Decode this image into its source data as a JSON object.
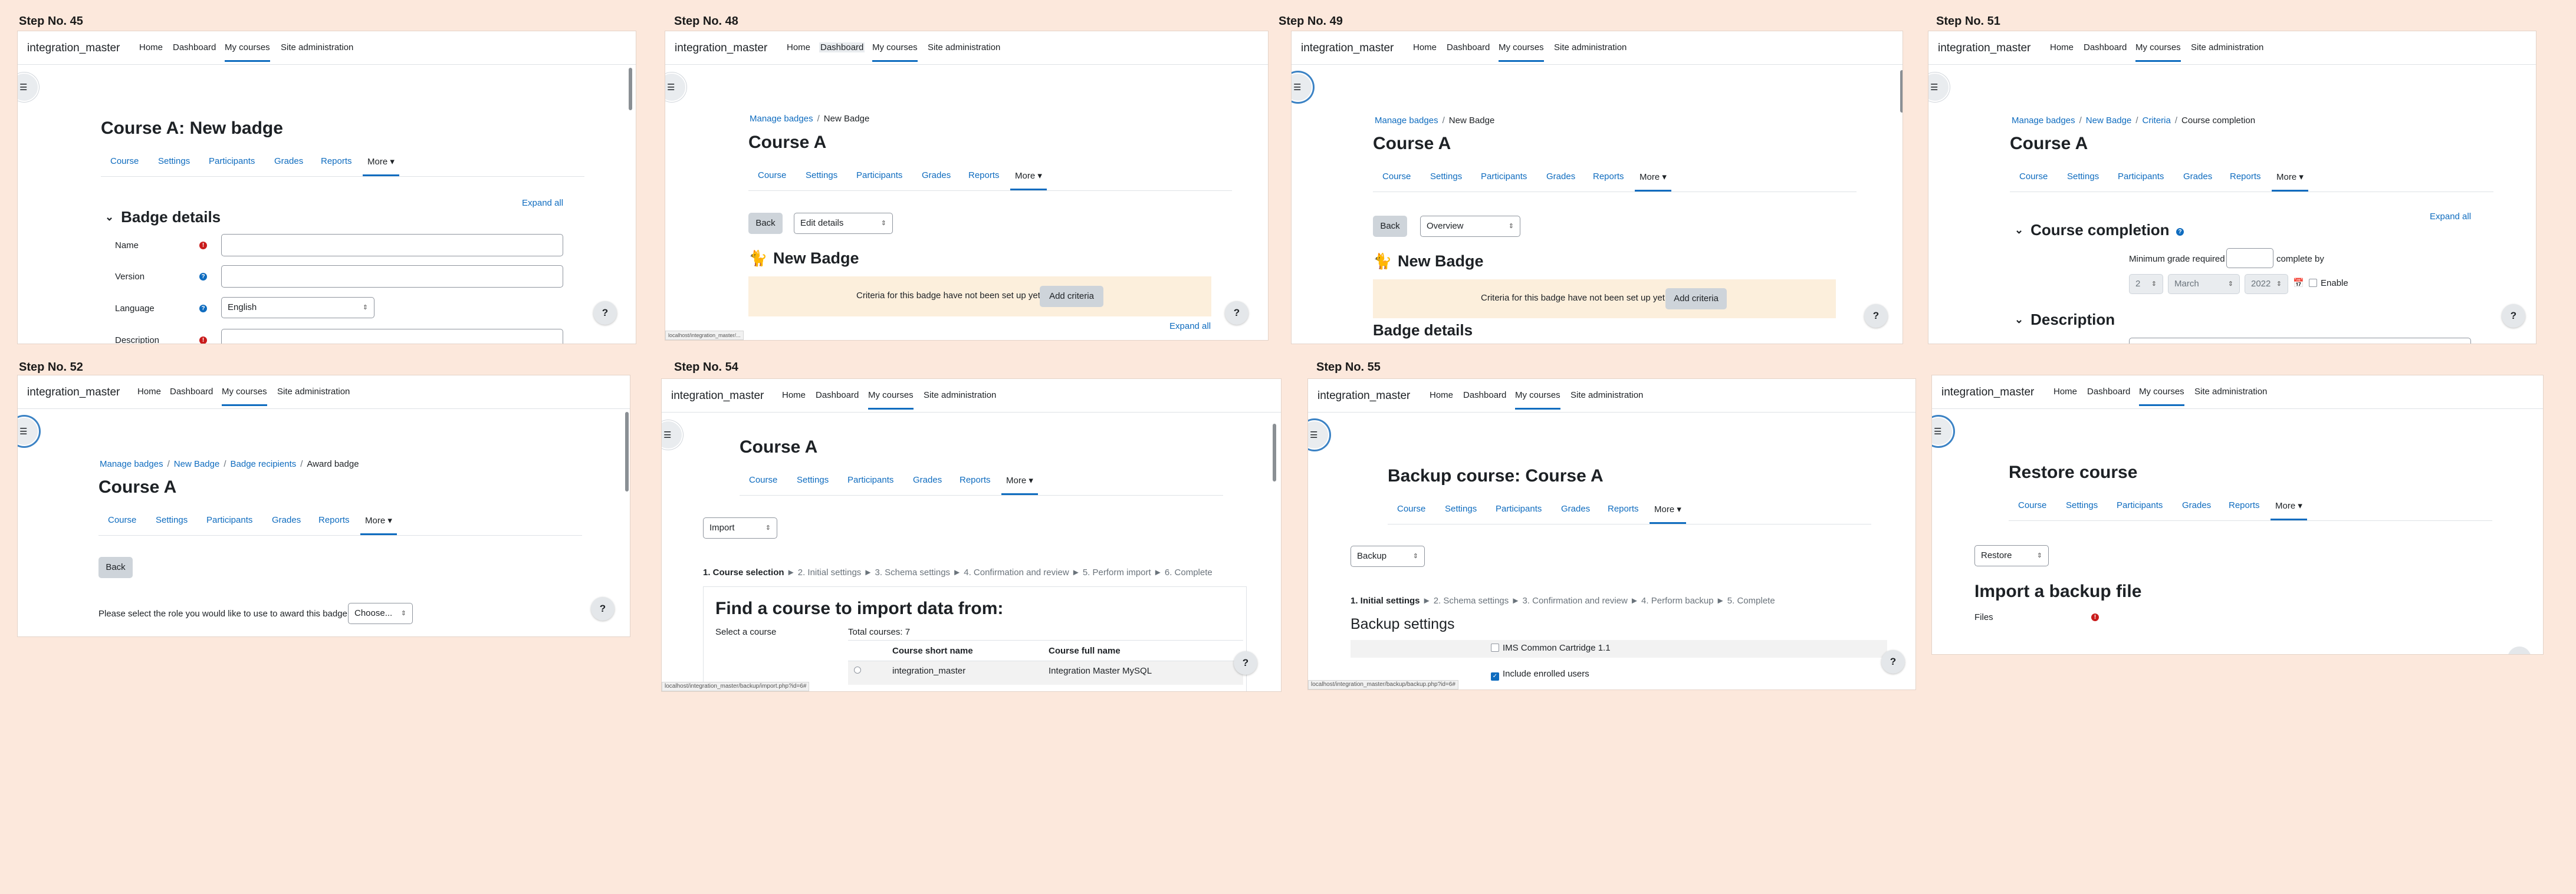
{
  "nav": {
    "brand": "integration_master",
    "home": "Home",
    "dashboard": "Dashboard",
    "my_courses": "My courses",
    "site_admin": "Site administration"
  },
  "tabs": {
    "course": "Course",
    "settings": "Settings",
    "participants": "Participants",
    "grades": "Grades",
    "reports": "Reports",
    "more": "More ▾"
  },
  "common": {
    "help": "?",
    "course_title": "Course A",
    "expand_all": "Expand all",
    "back": "Back"
  },
  "steps": {
    "s45": "Step No. 45",
    "s48": "Step No. 48",
    "s49": "Step No. 49",
    "s51": "Step No. 51",
    "s52": "Step No. 52",
    "s54": "Step No. 54",
    "s55": "Step No. 55"
  },
  "panel45": {
    "title": "Course A: New badge",
    "section": "Badge details",
    "name_label": "Name",
    "version_label": "Version",
    "language_label": "Language",
    "language_value": "English",
    "description_label": "Description"
  },
  "panel48": {
    "crumb1": "Manage badges",
    "crumb2": "New Badge",
    "select": "Edit details",
    "badge_name": "New Badge",
    "alert": "Criteria for this badge have not been set up yet.",
    "add_criteria": "Add criteria",
    "status": "localhost/integration_master/..."
  },
  "panel49": {
    "crumb1": "Manage badges",
    "crumb2": "New Badge",
    "select": "Overview",
    "badge_name": "New Badge",
    "alert": "Criteria for this badge have not been set up yet.",
    "add_criteria": "Add criteria",
    "section": "Badge details"
  },
  "panel51": {
    "crumb1": "Manage badges",
    "crumb2": "New Badge",
    "crumb3": "Criteria",
    "crumb4": "Course completion",
    "section": "Course completion",
    "min_grade": "Minimum grade required",
    "complete_by": "complete by",
    "day": "2",
    "month": "March",
    "year": "2022",
    "enable": "Enable",
    "section2": "Description"
  },
  "panel52": {
    "crumb1": "Manage badges",
    "crumb2": "New Badge",
    "crumb3": "Badge recipients",
    "crumb4": "Award badge",
    "prompt": "Please select the role you would like to use to award this badge:",
    "choose": "Choose..."
  },
  "panel54": {
    "select": "Import",
    "step1": "1. Course selection",
    "rest": " ► 2. Initial settings ► 3. Schema settings ► 4. Confirmation and review ► 5. Perform import ► 6. Complete",
    "heading": "Find a course to import data from:",
    "select_course": "Select a course",
    "total": "Total courses: 7",
    "col1": "Course short name",
    "col2": "Course full name",
    "row_short": "integration_master",
    "row_full": "Integration Master MySQL",
    "status": "localhost/integration_master/backup/import.php?id=6#"
  },
  "panel55": {
    "title": "Backup course: Course A",
    "select": "Backup",
    "step1": "1. Initial settings",
    "rest": " ► 2. Schema settings ► 3. Confirmation and review ► 4. Perform backup ► 5. Complete",
    "section": "Backup settings",
    "ims": "IMS Common Cartridge 1.1",
    "enrolled": "Include enrolled users",
    "status": "localhost/integration_master/backup/backup.php?id=6#"
  },
  "panel56": {
    "title": "Restore course",
    "select": "Restore",
    "heading": "Import a backup file",
    "files": "Files"
  }
}
